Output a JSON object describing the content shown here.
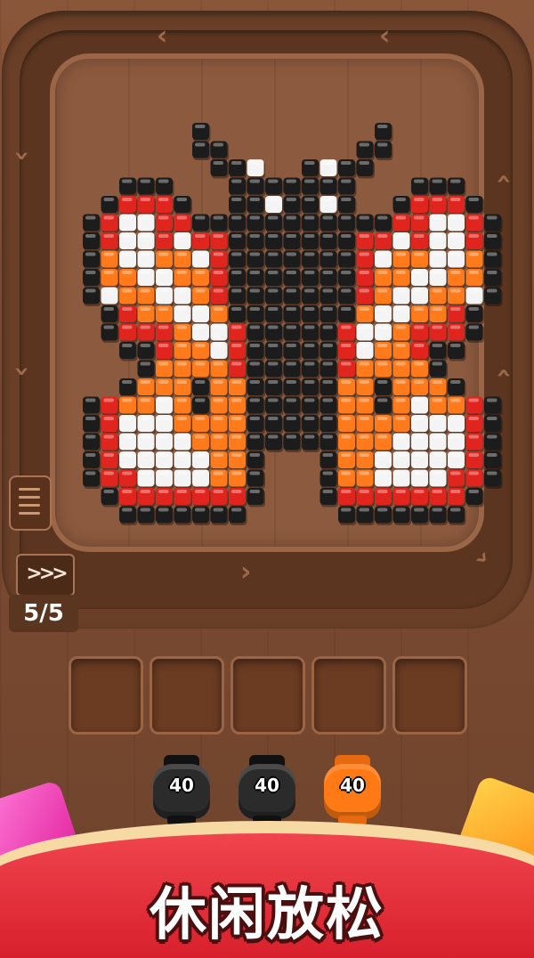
{
  "game": {
    "progress_text": "5/5",
    "speed_label": ">>>",
    "slots_count": 5,
    "collectors": [
      {
        "value": "40",
        "color": "#2b2b2b",
        "name": "black"
      },
      {
        "value": "40",
        "color": "#2b2b2b",
        "name": "black"
      },
      {
        "value": "40",
        "color": "#ff7a14",
        "name": "orange"
      }
    ],
    "banner_text": "休闲放松"
  },
  "palette": {
    "K": "#1c1c1c",
    "R": "#e0241e",
    "O": "#ff7a1a",
    "W": "#f4f4f4"
  },
  "pixel_art": [
    "......K.........K......",
    "......KK.......KK......",
    ".......KKW..KWKK.......",
    "..KKK...KKKKKKK...KKK..",
    ".KRRRK..KKWKKWK..KRRRK.",
    "KRWWRRKKKKKKKKKKKRRWWRK",
    "KRWWRWRRKKKKKKKRRWRWWRK",
    "KOWWOOWRKKKKKKKRWOOWWOK",
    "KOOWWOORKKKKKKKROOWWOOK",
    "KWOOWWORKKKKKKKROWWOOWK",
    ".KROOWWOKKKKKKKOWWOORK.",
    ".KRRROWWRKKKKKRWWORRRK.",
    "..KKROOWRKKKKKRWOORKK..",
    "...KOOOORKKKKKROOOOK...",
    "..KOOOKOOKKKKKOOKOOOK..",
    "KROOWOKOOKKKKKOOKOWOORK",
    "KRWWWOOOOKKKKKOOOOWWWRK",
    "KRWWWWOOOKKKKKOOOWWWWRK",
    "KRWWWWWOOK...KOOWWWWWRK",
    "KRRWWWWOOK...KOOWWWWRRK",
    ".KRRRRRRRK...KRRRRRRRK.",
    "..KKKKKKK.....KKKKKKK.."
  ]
}
